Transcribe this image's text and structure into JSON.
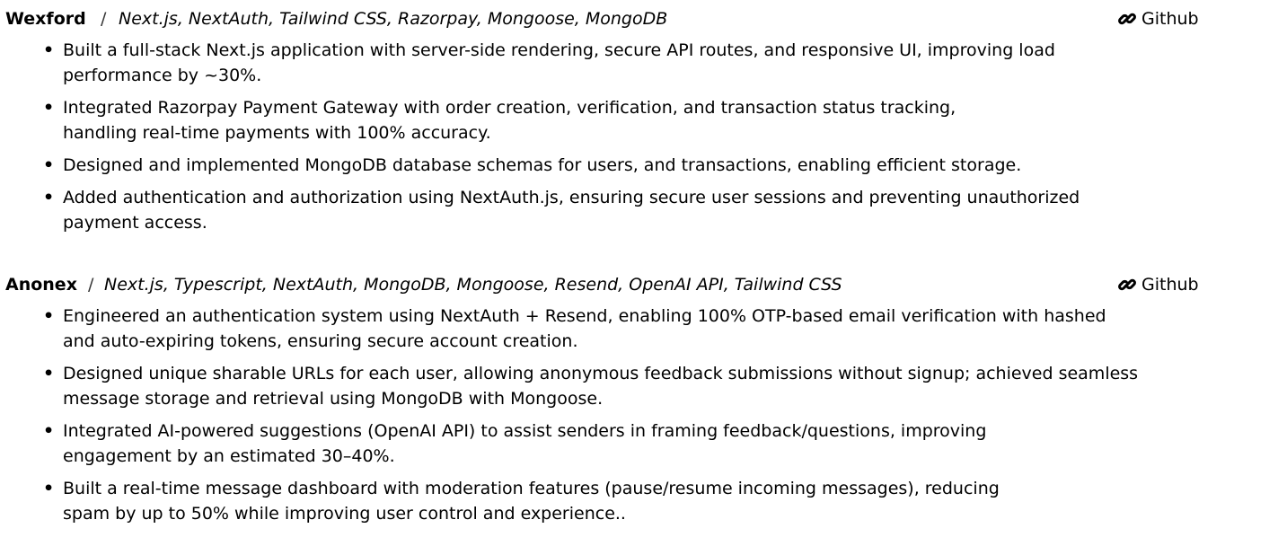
{
  "projects": [
    {
      "name": "Wexford",
      "separator": "/",
      "tech": "Next.js, NextAuth, Tailwind CSS, Razorpay, Mongoose, MongoDB",
      "link_label": "Github",
      "link_icon": "link-icon",
      "bullets": [
        {
          "line1": "Built a full-stack Next.js application with server-side rendering, secure API routes, and responsive UI, improving load",
          "line2": "performance by ~30%."
        },
        {
          "line1": "Integrated Razorpay Payment Gateway with order creation, verification, and transaction status tracking,",
          "line2": "handling real-time payments with 100% accuracy."
        },
        {
          "line1": "Designed and implemented MongoDB database schemas for users, and transactions, enabling efficient storage.",
          "line2": ""
        },
        {
          "line1": "Added authentication and authorization using NextAuth.js, ensuring secure user sessions and preventing unauthorized",
          "line2": "payment access."
        }
      ]
    },
    {
      "name": "Anonex",
      "separator": "/",
      "tech": "Next.js, Typescript, NextAuth, MongoDB, Mongoose, Resend, OpenAI API, Tailwind CSS",
      "link_label": "Github",
      "link_icon": "link-icon",
      "bullets": [
        {
          "line1": "Engineered an authentication system using NextAuth + Resend, enabling 100% OTP-based email verification with hashed",
          "line2": "and auto-expiring tokens, ensuring secure account creation."
        },
        {
          "line1": "Designed unique sharable URLs for each user, allowing anonymous feedback submissions without signup; achieved seamless",
          "line2": "message storage and retrieval using MongoDB with Mongoose."
        },
        {
          "line1": "Integrated AI-powered suggestions (OpenAI API) to assist senders in framing feedback/questions, improving",
          "line2": "engagement by an estimated 30–40%."
        },
        {
          "line1": "Built a real-time message dashboard with moderation features (pause/resume incoming messages), reducing",
          "line2": "spam by up to 50% while improving user control and experience.."
        }
      ]
    }
  ],
  "bullet_symbol": "•"
}
